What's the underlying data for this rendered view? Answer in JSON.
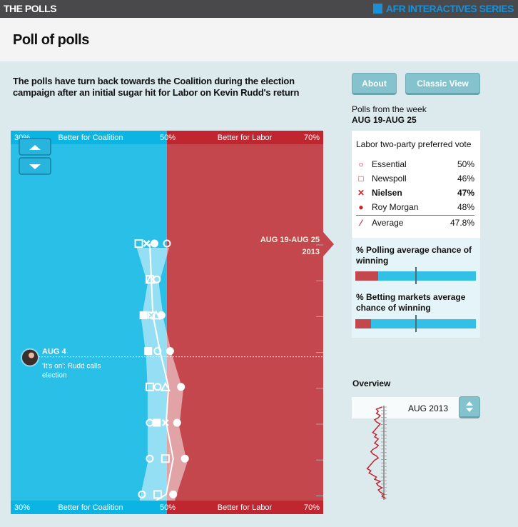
{
  "header": {
    "brand": "THE POLLS",
    "series": "AFR INTERACTIVES SERIES"
  },
  "page": {
    "title": "Poll of polls",
    "intro": "The polls have turn back towards the Coalition during the election campaign after an initial sugar hit for Labor on Kevin Rudd's return"
  },
  "buttons": {
    "about": "About",
    "classic": "Classic View"
  },
  "week": {
    "label": "Polls from the week",
    "range": "AUG 19-AUG 25"
  },
  "legend": {
    "title": "Labor two-party preferred vote",
    "items": [
      {
        "icon": "circle-outline",
        "name": "Essential",
        "value": "50%",
        "bold": false
      },
      {
        "icon": "square-outline",
        "name": "Newspoll",
        "value": "46%",
        "bold": false
      },
      {
        "icon": "cross",
        "name": "Nielsen",
        "value": "47%",
        "bold": true
      },
      {
        "icon": "filled-circle",
        "name": "Roy Morgan",
        "value": "48%",
        "bold": false
      }
    ],
    "average": {
      "icon": "slash-line",
      "name": "Average",
      "value": "47.8%"
    }
  },
  "probabilities": {
    "polling": {
      "label": "% Polling average chance of winning",
      "labor_fraction": 0.19
    },
    "betting": {
      "label": "% Betting markets average chance of winning",
      "labor_fraction": 0.13
    }
  },
  "overview": {
    "title": "Overview",
    "month": "AUG 2013",
    "series": [
      49,
      46,
      47,
      46,
      48,
      47,
      45,
      46,
      48,
      47,
      46,
      45,
      44,
      46,
      45,
      47,
      46,
      45,
      47,
      46,
      44,
      43,
      44,
      46,
      47,
      45,
      44,
      43,
      42,
      41,
      43,
      42,
      44,
      46,
      45,
      48,
      46,
      47,
      49,
      47,
      48,
      50,
      49,
      51
    ]
  },
  "chart_data": {
    "type": "scatter",
    "xlim": [
      30,
      70
    ],
    "x_ticks": [
      "30%",
      "50%",
      "70%"
    ],
    "side_labels": {
      "left": "Better for Coalition",
      "right": "Better for Labor"
    },
    "colors": {
      "coalition": "#29bfe7",
      "labor": "#c4474e",
      "coalition_bar": "#0bb4e3",
      "labor_bar": "#c0262f"
    },
    "current_week": {
      "range": "AUG 19-AUG 25",
      "year": "2013"
    },
    "annotation": {
      "date": "AUG 4",
      "text": "'It's on': Rudd calls election",
      "row": 3
    },
    "rows": [
      {
        "average": 47.8,
        "points": [
          {
            "m": "square",
            "v": 46.4
          },
          {
            "m": "cross",
            "v": 47.4
          },
          {
            "m": "dot",
            "v": 48.4
          },
          {
            "m": "circle",
            "v": 50
          }
        ]
      },
      {
        "average": 48.0,
        "points": [
          {
            "m": "square",
            "v": 47.8
          },
          {
            "m": "triangle",
            "v": 47.9
          },
          {
            "m": "circle",
            "v": 48.7
          }
        ]
      },
      {
        "average": 48.2,
        "points": [
          {
            "m": "fsquare",
            "v": 47
          },
          {
            "m": "xsquare",
            "v": 48
          },
          {
            "m": "triangle",
            "v": 48.6
          },
          {
            "m": "dot",
            "v": 49.3
          }
        ]
      },
      {
        "average": 49.1,
        "points": [
          {
            "m": "fsquare",
            "v": 47.6
          },
          {
            "m": "circle",
            "v": 48.8
          },
          {
            "m": "dot",
            "v": 50.4
          }
        ]
      },
      {
        "average": 50.2,
        "points": [
          {
            "m": "square",
            "v": 47.8
          },
          {
            "m": "circle",
            "v": 48.8
          },
          {
            "m": "triangle",
            "v": 49.8
          },
          {
            "m": "dot",
            "v": 51.8
          }
        ]
      },
      {
        "average": 49.9,
        "points": [
          {
            "m": "circle",
            "v": 47.8
          },
          {
            "m": "fsquare",
            "v": 48.7
          },
          {
            "m": "cross",
            "v": 49.8
          },
          {
            "m": "dot",
            "v": 51.3
          }
        ]
      },
      {
        "average": 50.8,
        "points": [
          {
            "m": "circle",
            "v": 47.8
          },
          {
            "m": "square",
            "v": 49.8
          },
          {
            "m": "dot",
            "v": 52.3
          }
        ]
      },
      {
        "average": 49.9,
        "points": [
          {
            "m": "circle",
            "v": 46.8
          },
          {
            "m": "square",
            "v": 48.8
          },
          {
            "m": "dot",
            "v": 50.8
          }
        ]
      }
    ]
  }
}
